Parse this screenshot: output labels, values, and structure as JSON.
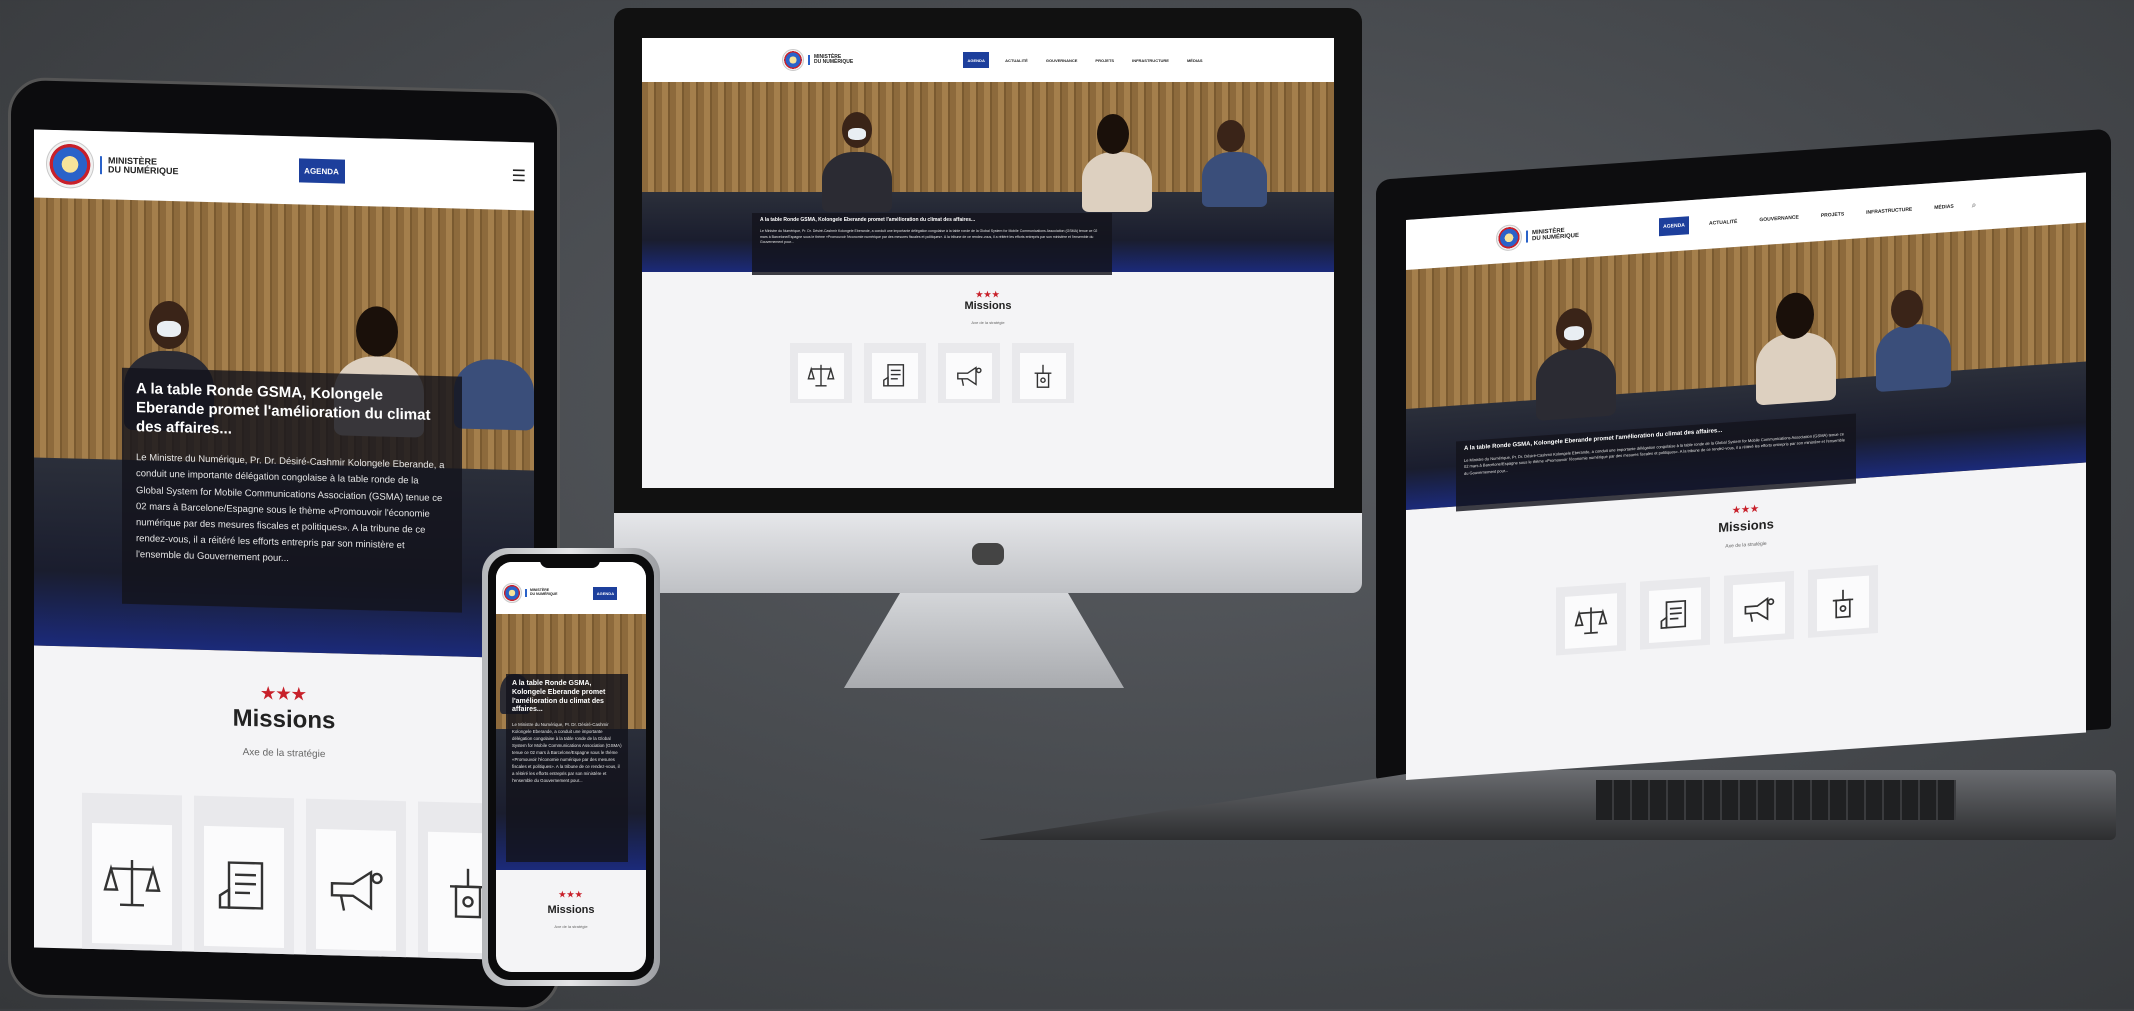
{
  "site": {
    "logo_line1": "MINISTÈRE",
    "logo_line2": "DU NUMÉRIQUE",
    "agenda_label": "AGENDA",
    "menu": [
      "ACTUALITÉ",
      "GOUVERNANCE",
      "PROJETS",
      "INFRASTRUCTURE",
      "MÉDIAS"
    ],
    "headline": "A la table Ronde GSMA, Kolongele Eberande promet l'amélioration du climat des affaires...",
    "article": "Le Ministre du Numérique, Pr. Dr. Désiré-Cashmir Kolongele Eberande, a conduit une importante délégation congolaise à la table ronde de la Global System for Mobile Communications Association (GSMA) tenue ce 02 mars à Barcelone/Espagne sous le thème «Promouvoir l'économie numérique par des mesures fiscales et politiques». A la tribune de ce rendez-vous, il a réitéré les efforts entrepris par son ministère et l'ensemble du Gouvernement pour...",
    "stars": "★★★",
    "missions_title": "Missions",
    "missions_subtitle": "Axe de la stratégie"
  },
  "icons": [
    "scales-icon",
    "document-icon",
    "megaphone-icon",
    "podium-icon"
  ],
  "colors": {
    "brand_blue": "#1d3f9c",
    "accent_red": "#c8202a",
    "background": "#45484c"
  }
}
